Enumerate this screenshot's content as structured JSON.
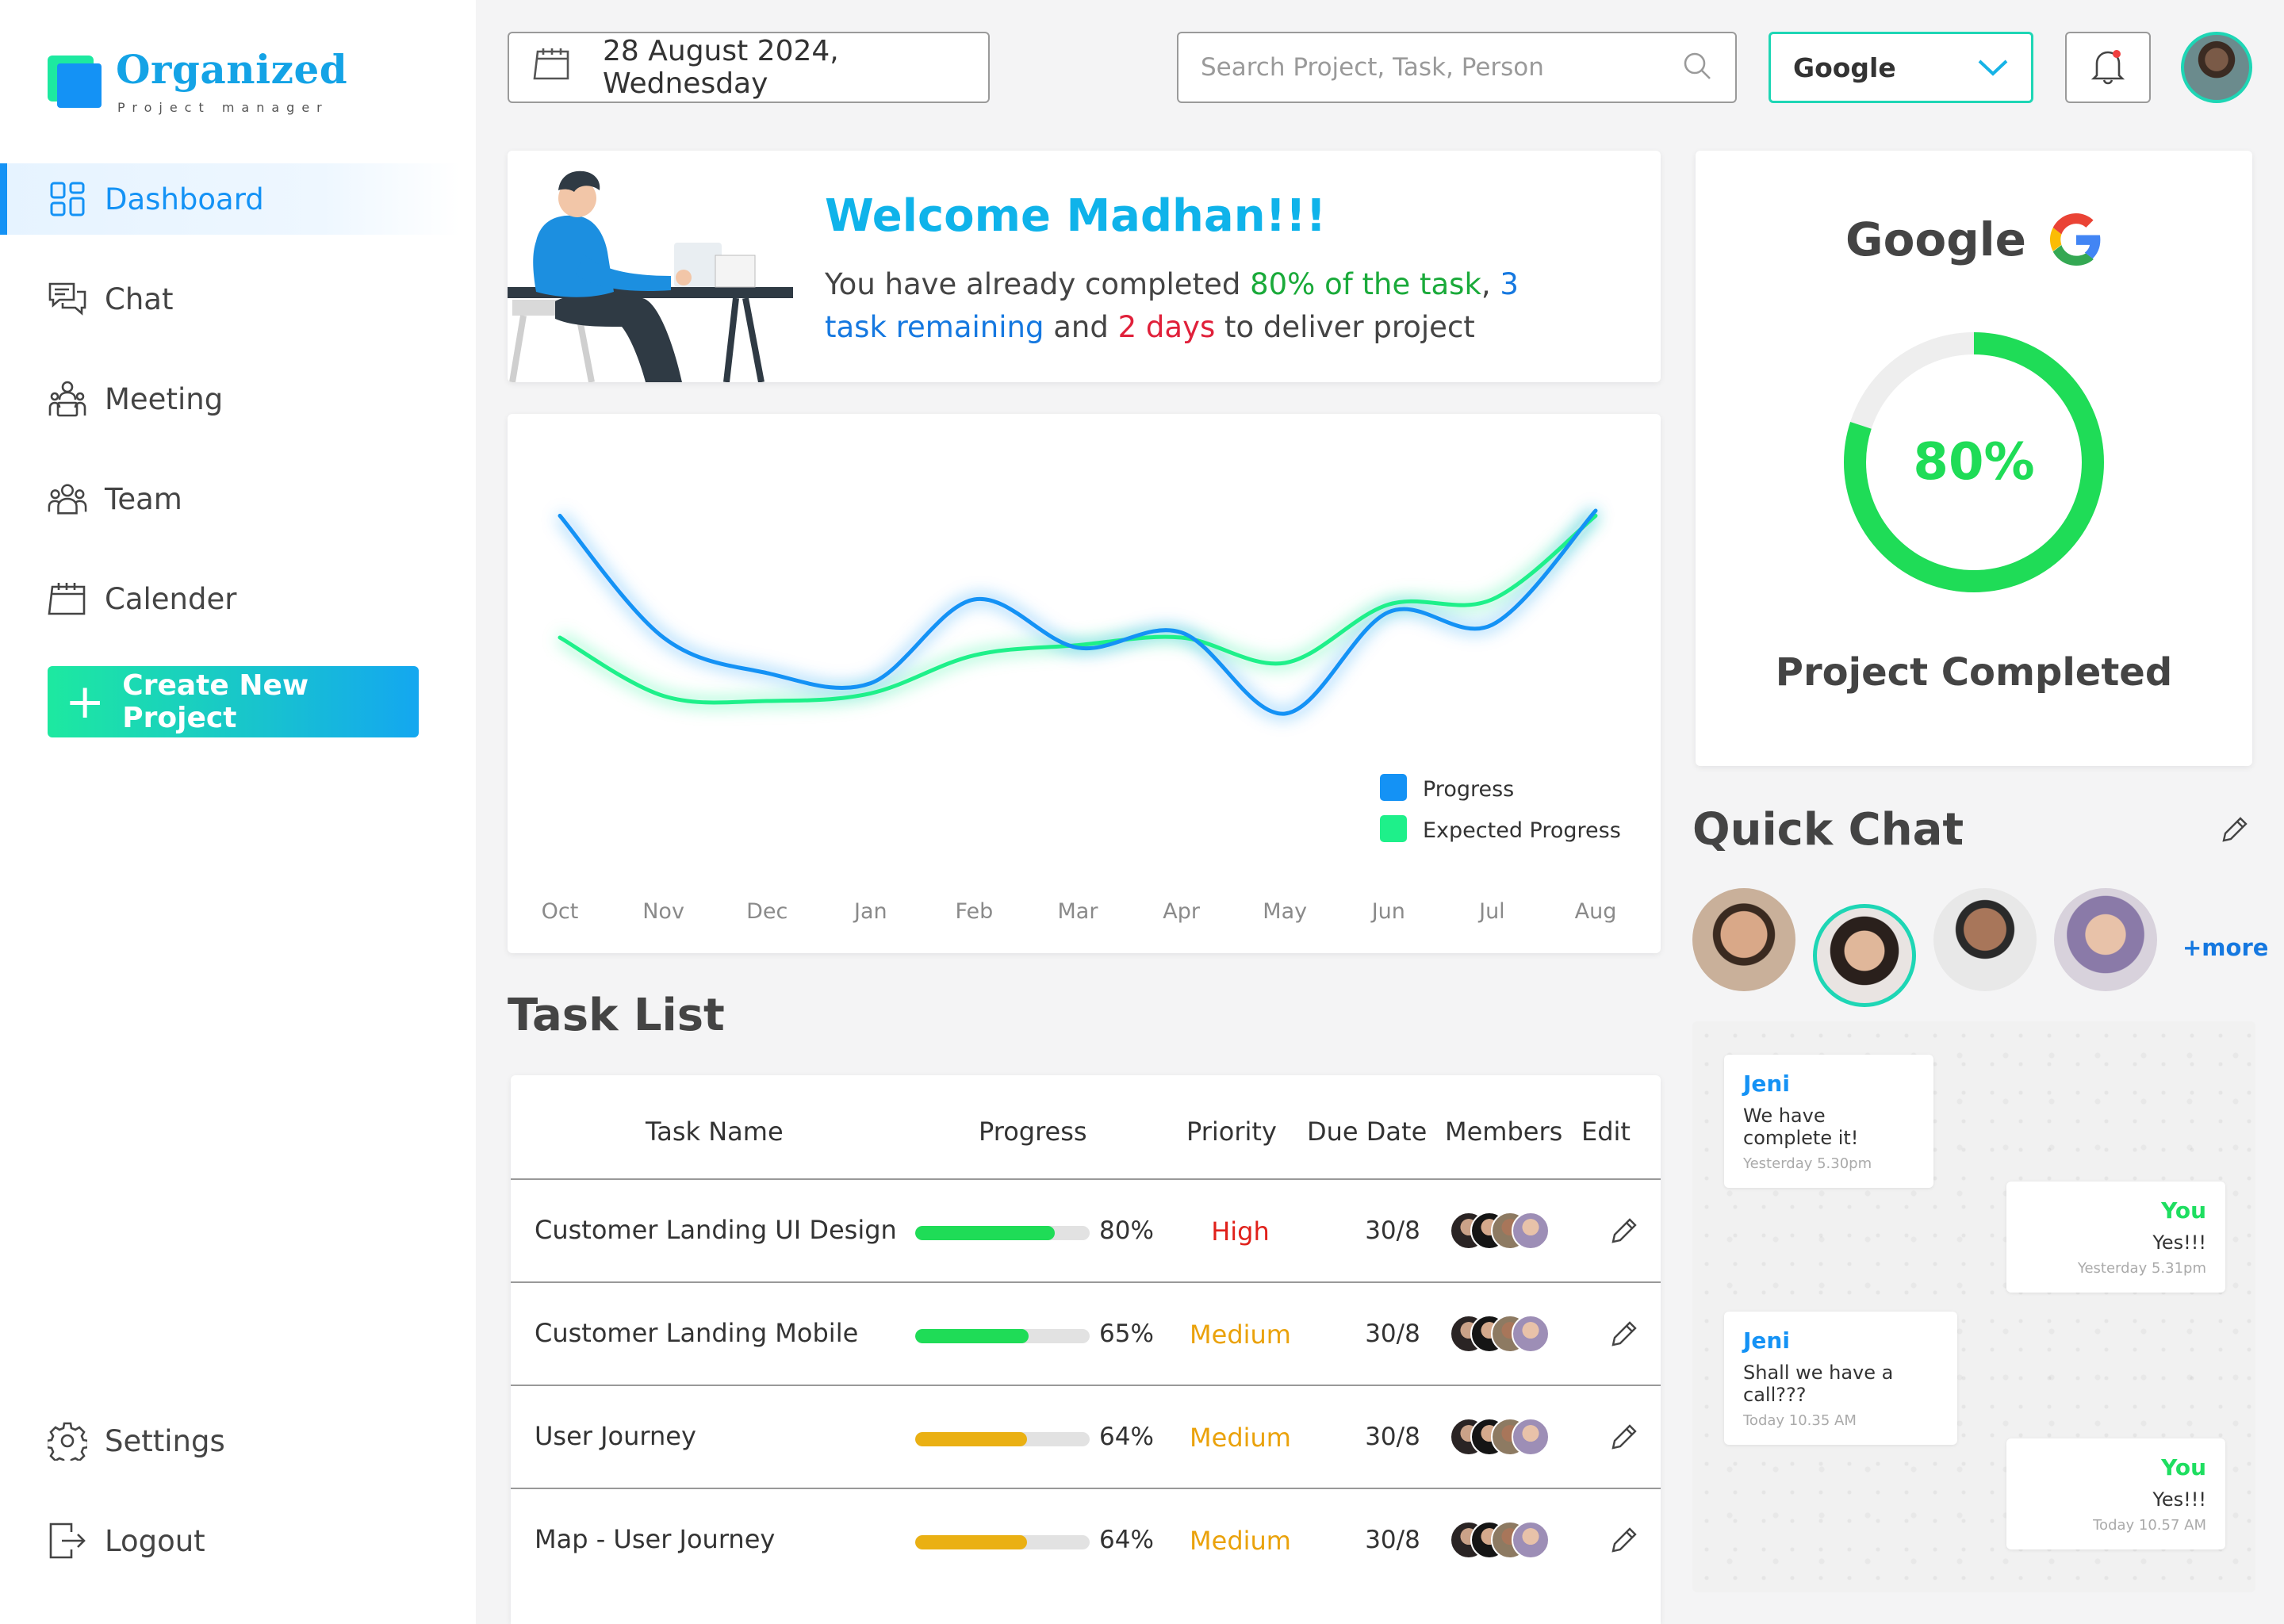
{
  "brand": {
    "name": "Organized",
    "tagline": "Project manager"
  },
  "nav": {
    "items": [
      {
        "label": "Dashboard",
        "icon": "dashboard-grid-icon",
        "active": true
      },
      {
        "label": "Chat",
        "icon": "chat-bubbles-icon"
      },
      {
        "label": "Meeting",
        "icon": "meeting-icon"
      },
      {
        "label": "Team",
        "icon": "team-icon"
      },
      {
        "label": "Calender",
        "icon": "calendar-icon"
      }
    ],
    "create_label": "Create New Project",
    "settings_label": "Settings",
    "logout_label": "Logout"
  },
  "header": {
    "date": "28 August 2024, Wednesday",
    "search_placeholder": "Search Project, Task, Person",
    "project": "Google"
  },
  "welcome": {
    "title": "Welcome Madhan!!!",
    "p1": "You have already completed ",
    "p2": "80% of the task",
    "p3": ", ",
    "p4": "3 task remaining",
    "p5": " and ",
    "p6": "2 days",
    "p7": " to deliver project"
  },
  "chart_data": {
    "type": "line",
    "categories": [
      "Oct",
      "Nov",
      "Dec",
      "Jan",
      "Feb",
      "Mar",
      "Apr",
      "May",
      "Jun",
      "Jul",
      "Aug"
    ],
    "series": [
      {
        "name": "Progress",
        "color": "#1492f5",
        "values": [
          88,
          40,
          26,
          22,
          55,
          36,
          42,
          10,
          50,
          45,
          90
        ]
      },
      {
        "name": "Expected Progress",
        "color": "#1ef08a",
        "values": [
          40,
          17,
          15,
          18,
          33,
          37,
          40,
          30,
          53,
          55,
          88
        ]
      }
    ],
    "ylim": [
      0,
      100
    ],
    "legend": "bottom-right",
    "grid": false
  },
  "project_status": {
    "name": "Google",
    "percent": 80,
    "percent_label": "80%",
    "label": "Project Completed"
  },
  "quick_chat": {
    "title": "Quick Chat",
    "more_label": "+more",
    "messages": [
      {
        "from": "Jeni",
        "text": "We have complete it!",
        "time": "Yesterday 5.30pm"
      },
      {
        "from": "You",
        "text": "Yes!!!",
        "time": "Yesterday 5.31pm"
      },
      {
        "from": "Jeni",
        "text": "Shall we have a call???",
        "time": "Today 10.35 AM"
      },
      {
        "from": "You",
        "text": "Yes!!!",
        "time": "Today 10.57 AM"
      }
    ]
  },
  "tasks": {
    "title": "Task List",
    "columns": [
      "Task Name",
      "Progress",
      "Priority",
      "Due Date",
      "Members",
      "Edit"
    ],
    "rows": [
      {
        "name": "Customer Landing  UI Design",
        "progress": 80,
        "progress_label": "80%",
        "priority": "High",
        "priority_color": "#e0201a",
        "bar_color": "#1fdc57",
        "due": "30/8"
      },
      {
        "name": "Customer Landing  Mobile",
        "progress": 65,
        "progress_label": "65%",
        "priority": "Medium",
        "priority_color": "#eaa20b",
        "bar_color": "#1fdc57",
        "due": "30/8"
      },
      {
        "name": "User Journey",
        "progress": 64,
        "progress_label": "64%",
        "priority": "Medium",
        "priority_color": "#eaa20b",
        "bar_color": "#eab013",
        "due": "30/8"
      },
      {
        "name": "Map - User Journey",
        "progress": 64,
        "progress_label": "64%",
        "priority": "Medium",
        "priority_color": "#eaa20b",
        "bar_color": "#eab013",
        "due": "30/8"
      }
    ]
  }
}
